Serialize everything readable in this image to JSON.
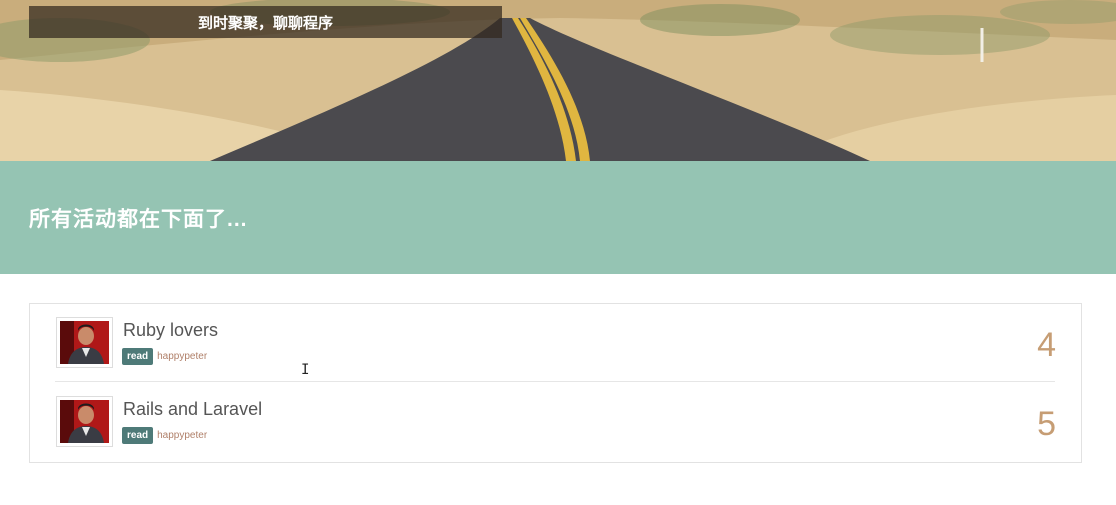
{
  "brand": {
    "title": "到时聚聚，聊聊程序"
  },
  "banner": {
    "heading": "所有活动都在下面了..."
  },
  "events": [
    {
      "title": "Ruby lovers",
      "badge": "read",
      "author": "happypeter",
      "count": "4"
    },
    {
      "title": "Rails and Laravel",
      "badge": "read",
      "author": "happypeter",
      "count": "5"
    }
  ],
  "colors": {
    "banner": "#95c4b3",
    "badge": "#4e7a78",
    "count": "#c69d74",
    "author": "#b0806a"
  },
  "icons": {
    "cursor": "text-cursor-icon"
  }
}
